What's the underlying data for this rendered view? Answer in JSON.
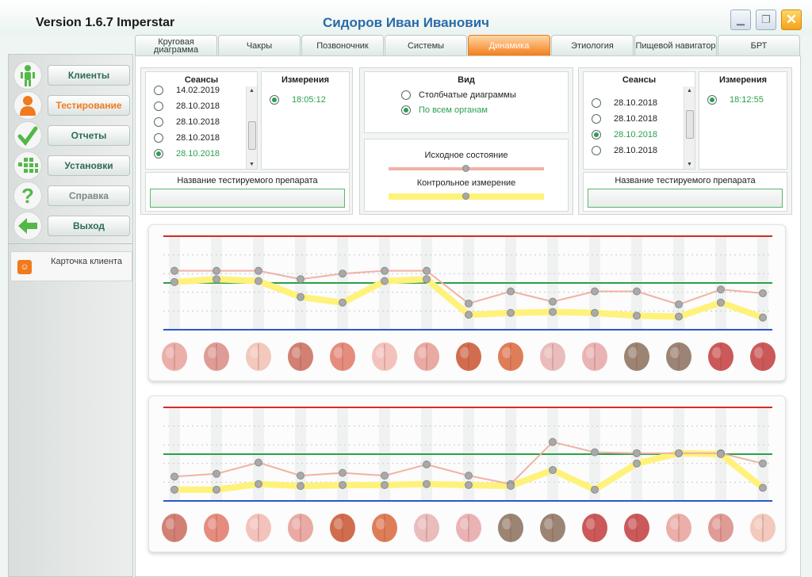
{
  "window": {
    "version": "Version 1.6.7 Imperstar",
    "user": "Сидоров  Иван  Иванович",
    "min_icon": "minimize-icon",
    "max_icon": "maximize-icon",
    "close_icon": "close-icon",
    "min_glyph": "▁",
    "max_glyph": "❐",
    "close_glyph": "✕"
  },
  "tabs": [
    {
      "label": "Круговая диаграмма",
      "active": false
    },
    {
      "label": "Чакры",
      "active": false
    },
    {
      "label": "Позвоночник",
      "active": false
    },
    {
      "label": "Системы",
      "active": false
    },
    {
      "label": "Динамика",
      "active": true
    },
    {
      "label": "Этиология",
      "active": false
    },
    {
      "label": "Пищевой навигатор",
      "active": false
    },
    {
      "label": "БРТ",
      "active": false
    }
  ],
  "sidebar": {
    "items": [
      {
        "label": "Клиенты",
        "icon": "person-icon",
        "icon_color": "#52b848",
        "state": "normal"
      },
      {
        "label": "Тестирование",
        "icon": "user-orange-icon",
        "icon_color": "#f07a1c",
        "state": "active"
      },
      {
        "label": "Отчеты",
        "icon": "checkmark-icon",
        "icon_color": "#52b848",
        "state": "normal"
      },
      {
        "label": "Установки",
        "icon": "grid-icon",
        "icon_color": "#52b848",
        "state": "normal"
      },
      {
        "label": "Справка",
        "icon": "question-icon",
        "icon_color": "#52b848",
        "state": "disabled"
      },
      {
        "label": "Выход",
        "icon": "arrow-left-icon",
        "icon_color": "#52b848",
        "state": "normal"
      }
    ],
    "card_label": "Карточка клиента"
  },
  "left": {
    "sessions_title": "Сеансы",
    "measurements_title": "Измерения",
    "sessions": [
      {
        "date": "14.02.2019",
        "checked": false
      },
      {
        "date": "28.10.2018",
        "checked": false
      },
      {
        "date": "28.10.2018",
        "checked": false
      },
      {
        "date": "28.10.2018",
        "checked": false
      },
      {
        "date": "28.10.2018",
        "checked": true
      }
    ],
    "measurements": [
      {
        "time": "18:05:12",
        "checked": true
      }
    ],
    "drug_label": "Название тестируемого препарата",
    "drug_value": ""
  },
  "view": {
    "title": "Вид",
    "options": [
      {
        "label": "Столбчатые диаграммы",
        "checked": false
      },
      {
        "label": "По всем органам",
        "checked": true
      }
    ],
    "slider1_label": "Исходное состояние",
    "slider1_value": 0.5,
    "slider2_label": "Контрольное измерение",
    "slider2_value": 0.5,
    "color_initial": "#f2b1a6",
    "color_control": "#fff27a"
  },
  "right": {
    "sessions_title": "Сеансы",
    "measurements_title": "Измерения",
    "sessions": [
      {
        "date": "28.10.2018",
        "checked": false
      },
      {
        "date": "28.10.2018",
        "checked": false
      },
      {
        "date": "28.10.2018",
        "checked": true
      },
      {
        "date": "28.10.2018",
        "checked": false
      }
    ],
    "measurements": [
      {
        "time": "18:12:55",
        "checked": true
      }
    ],
    "drug_label": "Название тестируемого препарата",
    "drug_value": ""
  },
  "chart_data": [
    {
      "type": "line",
      "series": [
        {
          "values": [
            0.63,
            0.63,
            0.63,
            0.54,
            0.6,
            0.63,
            0.63,
            0.28,
            0.41,
            0.3,
            0.41,
            0.41,
            0.27,
            0.43,
            0.39
          ]
        },
        {
          "values": [
            0.51,
            0.54,
            0.52,
            0.35,
            0.29,
            0.52,
            0.54,
            0.16,
            0.18,
            0.19,
            0.18,
            0.15,
            0.14,
            0.29,
            0.13
          ]
        }
      ],
      "organs": [
        "brain-front-icon",
        "brain-back-icon",
        "brain-side-icon",
        "eyes-left-icon",
        "eyes-right-icon",
        "nose-left-icon",
        "nose-right-icon",
        "thyroid-left-icon",
        "thyroid-right-icon",
        "ear-left-icon",
        "ear-right-icon",
        "nerve-left-icon",
        "nerve-right-icon",
        "vessels-icon",
        "heart-icon"
      ]
    },
    {
      "type": "line",
      "series": [
        {
          "values": [
            0.26,
            0.29,
            0.41,
            0.27,
            0.3,
            0.27,
            0.39,
            0.27,
            0.18,
            0.63,
            0.52,
            0.51,
            0.51,
            0.51,
            0.4
          ]
        },
        {
          "values": [
            0.12,
            0.12,
            0.18,
            0.16,
            0.17,
            0.17,
            0.18,
            0.17,
            0.16,
            0.33,
            0.12,
            0.4,
            0.51,
            0.5,
            0.14
          ]
        }
      ],
      "organs": [
        "trachea-icon",
        "larynx-icon",
        "lungs-small-left-icon",
        "lungs-small-right-icon",
        "bronchi-left-icon",
        "bronchi-right-icon",
        "lung-left-icon",
        "lung-right-icon",
        "stomach-icon",
        "liver-icon",
        "intestine-icon",
        "colon-icon",
        "bladder-icon",
        "kidney-left-icon",
        "kidney-right-icon"
      ]
    }
  ]
}
